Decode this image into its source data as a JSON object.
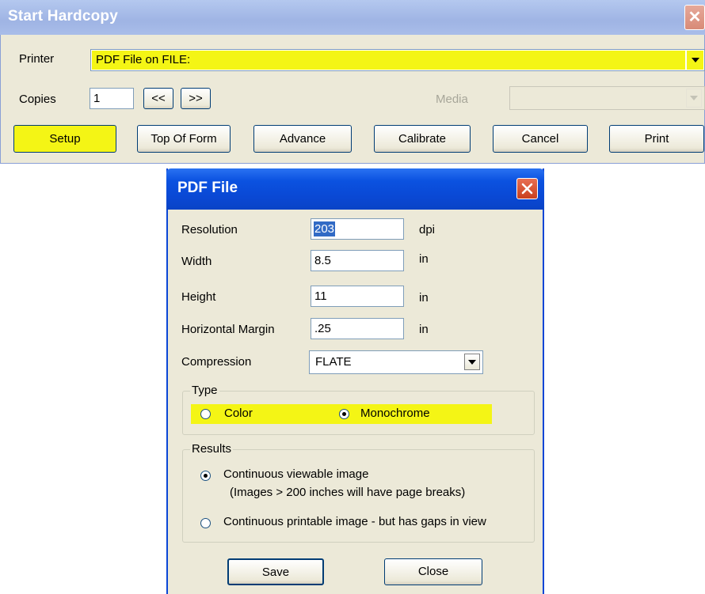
{
  "start_hardcopy": {
    "title": "Start Hardcopy",
    "printer_label": "Printer",
    "printer_value": "PDF File on FILE:",
    "copies_label": "Copies",
    "copies_value": "1",
    "prev_label": "<<",
    "next_label": ">>",
    "media_label": "Media",
    "media_value": "",
    "buttons": {
      "setup": "Setup",
      "top_of_form": "Top Of Form",
      "advance": "Advance",
      "calibrate": "Calibrate",
      "cancel": "Cancel",
      "print": "Print"
    }
  },
  "pdf_dialog": {
    "title": "PDF File",
    "fields": {
      "resolution": {
        "label": "Resolution",
        "value": "203",
        "unit": "dpi"
      },
      "width": {
        "label": "Width",
        "value": "8.5",
        "unit": "in"
      },
      "height": {
        "label": "Height",
        "value": "11",
        "unit": "in"
      },
      "horizontal_margin": {
        "label": "Horizontal Margin",
        "value": ".25",
        "unit": "in"
      }
    },
    "compression": {
      "label": "Compression",
      "value": "FLATE"
    },
    "type_group": {
      "label": "Type",
      "color_label": "Color",
      "monochrome_label": "Monochrome",
      "selected": "Monochrome"
    },
    "results_group": {
      "label": "Results",
      "option1_line1": "Continuous viewable image",
      "option1_line2": "(Images > 200 inches will have page breaks)",
      "option2": "Continuous printable image - but has gaps in view",
      "selected": "Continuous viewable image"
    },
    "buttons": {
      "save": "Save",
      "close": "Close"
    }
  },
  "colors": {
    "highlight": "#f4f515",
    "xp_blue": "#0a48d4",
    "dialog_bg": "#ece9d8"
  }
}
